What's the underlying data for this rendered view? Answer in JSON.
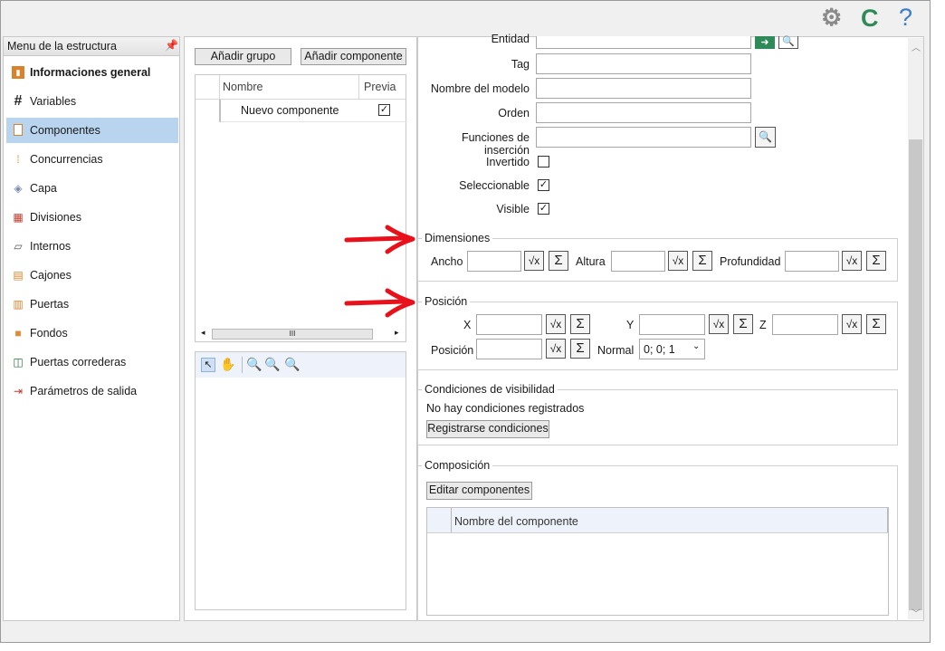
{
  "titlebar": {
    "icons": [
      "gear-icon",
      "refresh-icon",
      "help-icon"
    ],
    "help_glyph": "?",
    "refresh_glyph": "C",
    "gear_glyph": "⚙"
  },
  "menu": {
    "header": "Menu de la estructura",
    "pin_glyph": "ᵽ",
    "items": [
      {
        "label": "Informaciones general",
        "icon": "info-cabinet-icon",
        "glyph": "▣",
        "selected": false,
        "bold": true
      },
      {
        "label": "Variables",
        "icon": "hash-icon",
        "glyph": "#",
        "selected": false
      },
      {
        "label": "Componentes",
        "icon": "component-icon",
        "glyph": "▭",
        "selected": true
      },
      {
        "label": "Concurrencias",
        "icon": "concurrency-icon",
        "glyph": "⁞",
        "selected": false
      },
      {
        "label": "Capa",
        "icon": "layers-icon",
        "glyph": "◈",
        "selected": false
      },
      {
        "label": "Divisiones",
        "icon": "divisions-icon",
        "glyph": "▦",
        "selected": false
      },
      {
        "label": "Internos",
        "icon": "internals-icon",
        "glyph": "▱",
        "selected": false
      },
      {
        "label": "Cajones",
        "icon": "drawers-icon",
        "glyph": "▤",
        "selected": false
      },
      {
        "label": "Puertas",
        "icon": "doors-icon",
        "glyph": "▥",
        "selected": false
      },
      {
        "label": "Fondos",
        "icon": "backs-icon",
        "glyph": "■",
        "selected": false
      },
      {
        "label": "Puertas correderas",
        "icon": "sliding-doors-icon",
        "glyph": "◫",
        "selected": false
      },
      {
        "label": "Parámetros de salida",
        "icon": "output-params-icon",
        "glyph": "⇥",
        "selected": false
      }
    ]
  },
  "toolbar": {
    "add_group": "Añadir grupo",
    "add_component": "Añadir componente"
  },
  "grid": {
    "columns": [
      "Nombre",
      "Previa"
    ],
    "rows": [
      {
        "name": "Nuevo componente",
        "preview": true
      }
    ],
    "hscroll_glyph": "III",
    "left_arrow": "◂",
    "right_arrow": "▸"
  },
  "tree_tools": [
    "select-pointer-icon",
    "pan-hand-icon",
    "zoom-in-icon",
    "zoom-region-icon",
    "zoom-fit-icon"
  ],
  "form": {
    "entidad_label": "Entidad",
    "tag_label": "Tag",
    "model_label": "Nombre del modelo",
    "order_label": "Orden",
    "insert_label": "Funciones de inserción",
    "inverted_label": "Invertido",
    "inverted": false,
    "selectable_label": "Seleccionable",
    "selectable": true,
    "visible_label": "Visible",
    "visible": true
  },
  "dimensions": {
    "title": "Dimensiones",
    "width_label": "Ancho",
    "height_label": "Altura",
    "depth_label": "Profundidad"
  },
  "position": {
    "title": "Posición",
    "x_label": "X",
    "y_label": "Y",
    "z_label": "Z",
    "pos_label": "Posición",
    "normal_label": "Normal",
    "normal_value": "0; 0; 1"
  },
  "visibility": {
    "title": "Condiciones de visibilidad",
    "empty_text": "No hay condiciones registrados",
    "register_button": "Registrarse condiciones"
  },
  "composition": {
    "title": "Composición",
    "edit_button": "Editar componentes",
    "column": "Nombre del componente"
  },
  "colors": {
    "accent_selected": "#b8d4ee",
    "arrow_red": "#e8101a",
    "refresh_green": "#2e8b57",
    "help_blue": "#3a7fc8"
  }
}
